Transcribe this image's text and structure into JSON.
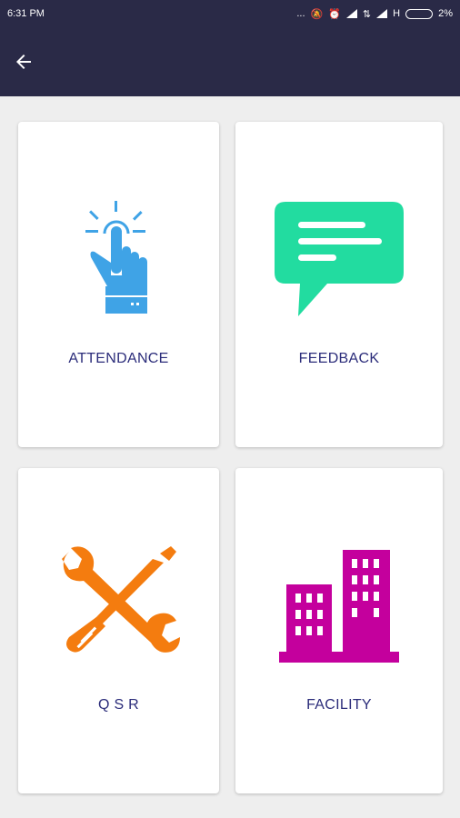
{
  "status_bar": {
    "time": "6:31 PM",
    "dots": "...",
    "network": "H",
    "battery": "2%"
  },
  "app_bar": {
    "back_icon": "arrow-left-icon"
  },
  "cards": [
    {
      "label": "ATTENDANCE",
      "icon": "tap-hand-icon",
      "color": "#3fa3e6"
    },
    {
      "label": "FEEDBACK",
      "icon": "chat-bubble-icon",
      "color": "#22dca0"
    },
    {
      "label": "Q S R",
      "icon": "tools-icon",
      "color": "#f47c0f"
    },
    {
      "label": "FACILITY",
      "icon": "buildings-icon",
      "color": "#c4009d"
    }
  ]
}
